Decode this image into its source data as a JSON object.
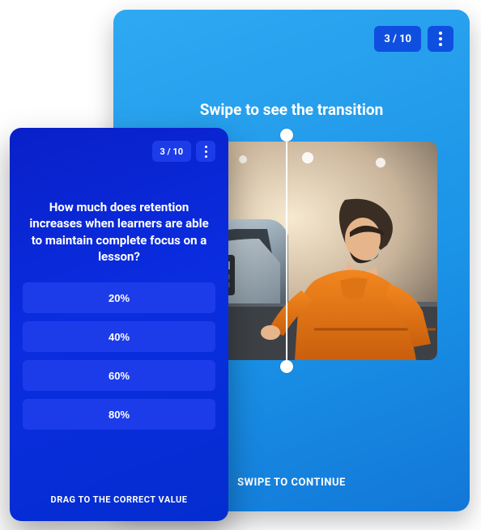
{
  "back_card": {
    "counter": "3 / 10",
    "title": "Swipe to see the transition",
    "swipe_text": "SWIPE TO CONTINUE"
  },
  "front_card": {
    "counter": "3 / 10",
    "question": "How much does retention increases when learners are able to maintain complete focus on a lesson?",
    "options": [
      "20%",
      "40%",
      "60%",
      "80%"
    ],
    "drag_text": "DRAG TO THE CORRECT VALUE"
  }
}
